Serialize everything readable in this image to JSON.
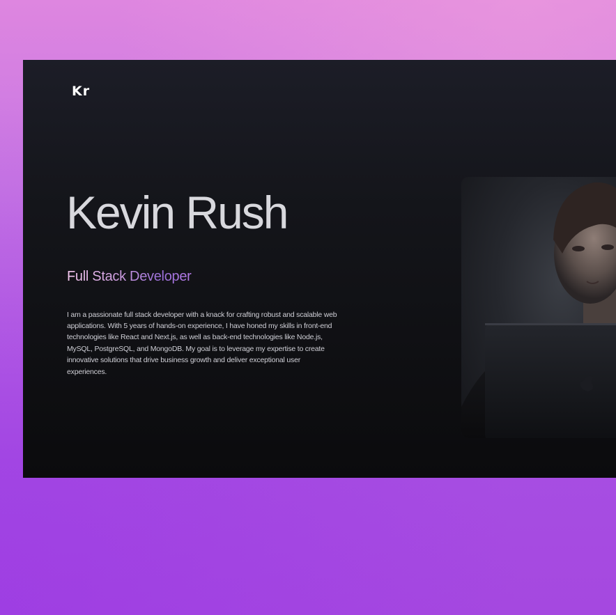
{
  "header": {
    "logo": "Kr"
  },
  "hero": {
    "name": "Kevin Rush",
    "role": "Full Stack Developer",
    "bio": "I am a passionate full stack developer with a knack for crafting robust and scalable web applications. With 5 years of hands-on experience, I have honed my skills in front-end technologies like React and Next.js, as well as back-end technologies like Node.js, MySQL, PostgreSQL, and MongoDB. My goal is to leverage my expertise to create innovative solutions that drive business growth and deliver exceptional user experiences."
  },
  "colors": {
    "background_top": "#de86e0",
    "background_bottom": "#a548e0",
    "window_top": "#1c1d27",
    "window_bottom": "#0b0b0d",
    "role_gradient_start": "#f4c7ef",
    "role_gradient_end": "#9a6fd8"
  }
}
